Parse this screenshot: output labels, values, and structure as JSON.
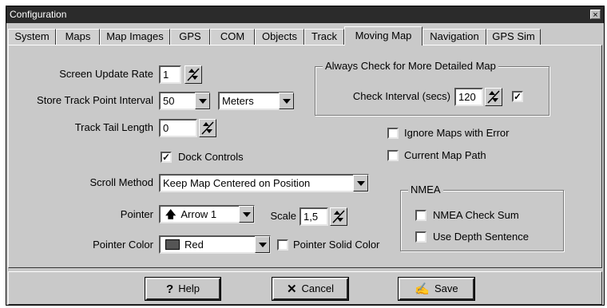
{
  "window": {
    "title": "Configuration",
    "close_glyph": "×"
  },
  "tabs": [
    {
      "label": "System"
    },
    {
      "label": "Maps"
    },
    {
      "label": "Map Images"
    },
    {
      "label": "GPS"
    },
    {
      "label": "COM"
    },
    {
      "label": "Objects"
    },
    {
      "label": "Track"
    },
    {
      "label": "Moving Map",
      "active": true
    },
    {
      "label": "Navigation"
    },
    {
      "label": "GPS Sim"
    }
  ],
  "form": {
    "screen_update_rate": {
      "label": "Screen Update Rate",
      "value": "1"
    },
    "store_track_point_interval": {
      "label": "Store Track Point Interval",
      "value": "50",
      "unit": "Meters"
    },
    "track_tail_length": {
      "label": "Track Tail Length",
      "value": "0"
    },
    "dock_controls": {
      "label": "Dock Controls",
      "checked": true
    },
    "scroll_method": {
      "label": "Scroll Method",
      "value": "Keep Map Centered on Position"
    },
    "pointer": {
      "label": "Pointer",
      "value": "Arrow 1",
      "icon": "up-arrow-icon"
    },
    "scale": {
      "label": "Scale",
      "value": "1,5"
    },
    "pointer_color": {
      "label": "Pointer Color",
      "value": "Red"
    },
    "pointer_solid_color": {
      "label": "Pointer Solid Color",
      "checked": false
    }
  },
  "detailed_map": {
    "title": "Always Check for More Detailed Map",
    "check_interval": {
      "label": "Check Interval (secs)",
      "value": "120",
      "checked": true
    }
  },
  "map_options": {
    "ignore_maps_with_error": {
      "label": "Ignore Maps with Error",
      "checked": false
    },
    "current_map_path": {
      "label": "Current Map Path",
      "checked": false
    }
  },
  "nmea": {
    "title": "NMEA",
    "check_sum": {
      "label": "NMEA Check Sum",
      "checked": false
    },
    "use_depth_sentence": {
      "label": "Use Depth Sentence",
      "checked": false
    }
  },
  "buttons": {
    "help": {
      "label": "Help",
      "icon": "question-icon",
      "glyph": "?"
    },
    "cancel": {
      "label": "Cancel",
      "icon": "x-icon",
      "glyph": "✕"
    },
    "save": {
      "label": "Save",
      "icon": "save-icon",
      "glyph": "✍"
    }
  },
  "check_glyph": "✓"
}
